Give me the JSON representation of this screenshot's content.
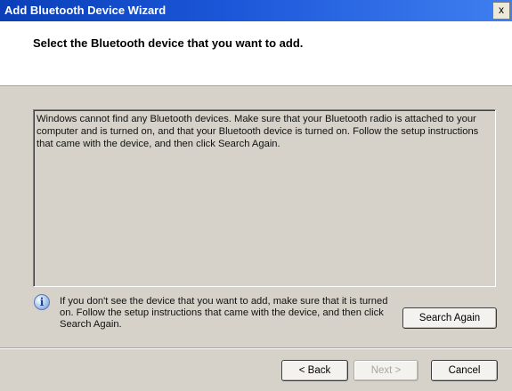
{
  "window": {
    "title": "Add Bluetooth Device Wizard",
    "close_glyph": "x"
  },
  "header": {
    "heading": "Select the Bluetooth device that you want to add."
  },
  "device_list": {
    "message": "Windows cannot find any Bluetooth devices. Make sure that your Bluetooth radio is attached to your computer and is turned on, and that your Bluetooth device is turned on. Follow the setup instructions that came with the device, and then click Search Again."
  },
  "info": {
    "icon": "info-icon",
    "icon_glyph": "i",
    "text": "If you don't see the device that you want to add, make sure that it is turned on. Follow the setup instructions that came with the device, and then click Search Again."
  },
  "buttons": {
    "search_again": "Search Again",
    "back": "< Back",
    "next": "Next >",
    "cancel": "Cancel"
  }
}
